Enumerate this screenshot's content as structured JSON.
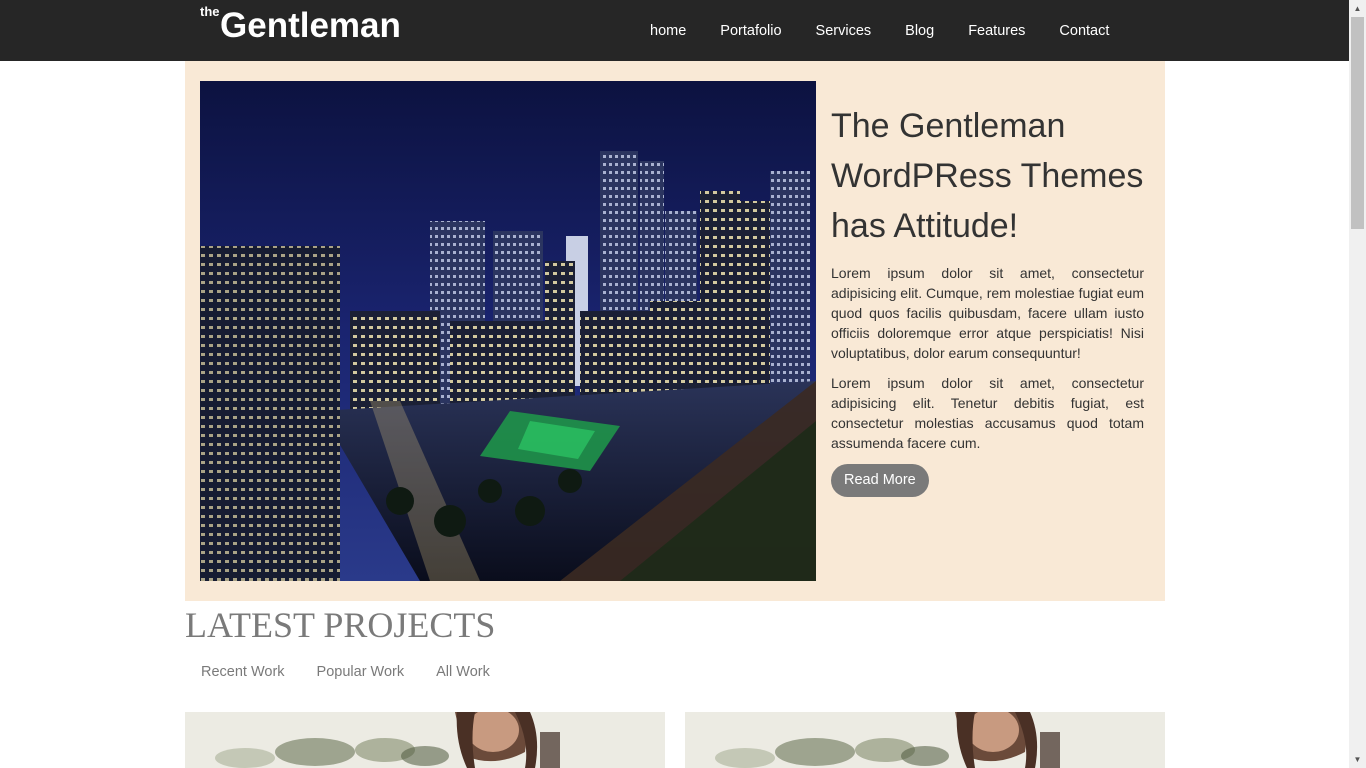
{
  "header": {
    "logo_small": "the",
    "logo_main": "Gentleman",
    "nav": [
      {
        "label": "home"
      },
      {
        "label": "Portafolio"
      },
      {
        "label": "Services"
      },
      {
        "label": "Blog"
      },
      {
        "label": "Features"
      },
      {
        "label": "Contact"
      }
    ]
  },
  "hero": {
    "title": "The Gentleman WordPRess Themes has Attitude!",
    "paragraph_1": "Lorem ipsum dolor sit amet, consectetur adipisicing elit. Cumque, rem molestiae fugiat eum quod quos facilis quibusdam, facere ullam iusto officiis doloremque error atque perspiciatis! Nisi voluptatibus, dolor earum consequuntur!",
    "paragraph_2": "Lorem ipsum dolor sit amet, consectetur adipisicing elit. Tenetur debitis fugiat, est consectetur molestias accusamus quod totam assumenda facere cum.",
    "button_label": "Read More",
    "background_color": "#f9e9d6"
  },
  "latest_projects": {
    "title": "LATEST PROJECTS",
    "filters": [
      {
        "label": "Recent Work"
      },
      {
        "label": "Popular Work"
      },
      {
        "label": "All Work"
      }
    ]
  },
  "colors": {
    "header_bg": "#262626",
    "button_bg": "#7a7a7a",
    "muted_text": "#7a7a7a"
  }
}
